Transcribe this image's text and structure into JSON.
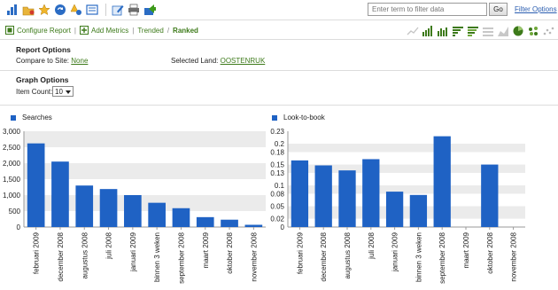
{
  "toolbar": {
    "icons": [
      "bar-chart-icon",
      "folder-icon",
      "star-icon",
      "sync-icon",
      "alert-icon",
      "download-icon",
      "edit-icon",
      "print-icon",
      "share-icon"
    ],
    "filter_placeholder": "Enter term to filter data",
    "go_label": "Go",
    "filter_options_label": "Filter Options"
  },
  "breadcrumb": {
    "configure_report": "Configure Report",
    "add_metrics": "Add Metrics",
    "trended": "Trended",
    "ranked": "Ranked",
    "separator": "|",
    "slash": "/"
  },
  "view_icons": [
    "trend-view-icon",
    "ranked-bar-view-icon",
    "bar-view-icon",
    "horizontal-bar-view-icon",
    "stacked-bar-view-icon",
    "list-view-icon",
    "area-view-icon",
    "pie-view-icon",
    "cluster-view-icon",
    "scatter-view-icon"
  ],
  "report_options": {
    "title": "Report Options",
    "compare_label": "Compare to Site:",
    "compare_value": "None",
    "land_label": "Selected Land:",
    "land_value": "OOSTENRUK"
  },
  "graph_options": {
    "title": "Graph Options",
    "item_count_label": "Item Count:",
    "item_count_value": "10"
  },
  "colors": {
    "bar": "#1f62c4",
    "link": "#3d7a1a",
    "band": "#ebebeb"
  },
  "chart_data": [
    {
      "type": "bar",
      "title": "",
      "xlabel": "",
      "ylabel": "",
      "categories": [
        "februari 2009",
        "december 2008",
        "augustus 2008",
        "juli 2008",
        "januari 2009",
        "binnen 3 weken",
        "september 2008",
        "maart 2009",
        "oktober 2008",
        "november 2008"
      ],
      "series": [
        {
          "name": "Searches",
          "values": [
            2620,
            2050,
            1300,
            1190,
            1000,
            760,
            590,
            310,
            230,
            70
          ]
        }
      ],
      "ylim": [
        0,
        3000
      ],
      "yticks": [
        0,
        500,
        1000,
        1500,
        2000,
        2500,
        3000
      ],
      "ytick_labels": [
        "0",
        "500",
        "1,000",
        "1,500",
        "2,000",
        "2,500",
        "3,000"
      ],
      "grid": "alternating bands",
      "legend": "top-left"
    },
    {
      "type": "bar",
      "title": "",
      "xlabel": "",
      "ylabel": "",
      "categories": [
        "februari 2009",
        "december 2008",
        "augustus 2008",
        "juli 2008",
        "januari 2009",
        "binnen 3 weken",
        "september 2008",
        "maart 2009",
        "oktober 2008",
        "november 2008"
      ],
      "series": [
        {
          "name": "Look-to-book",
          "values": [
            0.16,
            0.148,
            0.136,
            0.163,
            0.085,
            0.077,
            0.218,
            0,
            0.15,
            0
          ]
        }
      ],
      "ylim": [
        0,
        0.23
      ],
      "yticks": [
        0,
        0.02,
        0.05,
        0.08,
        0.1,
        0.13,
        0.15,
        0.18,
        0.2,
        0.23
      ],
      "ytick_labels": [
        "0",
        "0.02",
        "0.05",
        "0.08",
        "0.1",
        "0.13",
        "0.15",
        "0.18",
        "0.2",
        "0.23"
      ],
      "grid": "alternating bands",
      "legend": "top-left"
    }
  ]
}
